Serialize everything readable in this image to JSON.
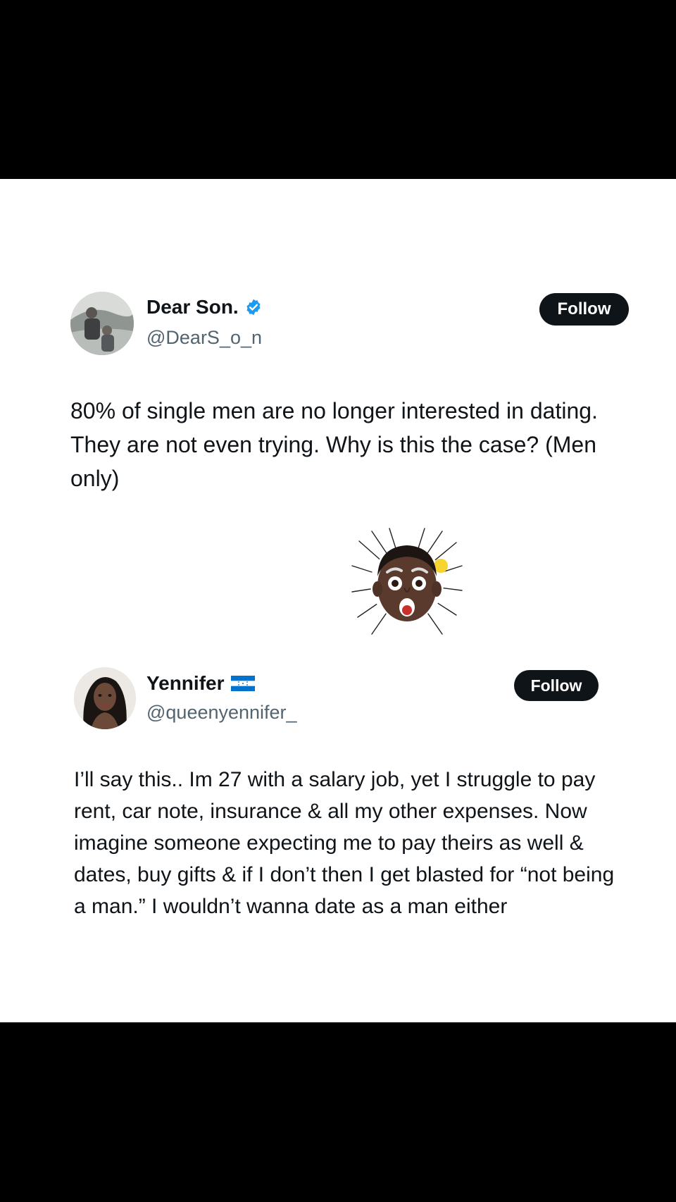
{
  "tweet1": {
    "display_name": "Dear Son.",
    "verified_icon": "verified-badge-icon",
    "handle": "@DearS_o_n",
    "follow_label": "Follow",
    "text": "80% of single men are no longer interested in dating. They are not even trying. Why is this the case? (Men only)"
  },
  "reaction": {
    "icon": "shocked-memoji-icon"
  },
  "tweet2": {
    "display_name": "Yennifer",
    "flag_icon": "honduras-flag-icon",
    "handle": "@queenyennifer_",
    "follow_label": "Follow",
    "text": "I’ll say this.. Im 27 with a salary job, yet I struggle to pay rent, car note, insurance & all my other expenses. Now imagine someone expecting me to pay theirs as well & dates, buy gifts & if I don’t then I get blasted for “not being a man.” I wouldn’t wanna date as a man either"
  },
  "colors": {
    "background": "#000000",
    "card": "#ffffff",
    "text": "#0f1419",
    "secondary_text": "#536471",
    "verified": "#1d9bf0",
    "follow_button": "#0f1419"
  }
}
